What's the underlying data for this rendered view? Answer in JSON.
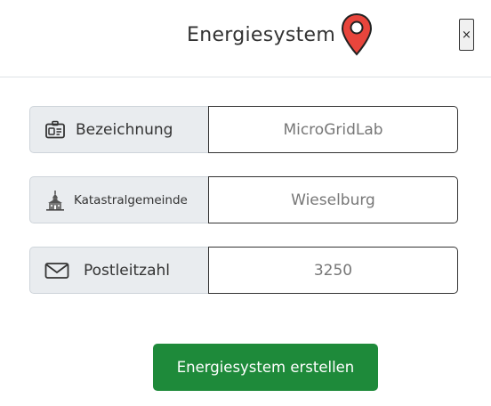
{
  "header": {
    "title": "Energiesystem",
    "close_label": "×",
    "pin_color": "#e8453c"
  },
  "form": {
    "fields": [
      {
        "label": "Bezeichnung",
        "icon": "id-card-icon",
        "value": "MicroGridLab"
      },
      {
        "label": "Katastralgemeinde",
        "icon": "town-hall-icon",
        "value": "Wieselburg"
      },
      {
        "label": "Postleitzahl",
        "icon": "envelope-icon",
        "value": "3250"
      }
    ],
    "submit_label": "Energiesystem erstellen",
    "submit_color": "#1e8a3a"
  }
}
